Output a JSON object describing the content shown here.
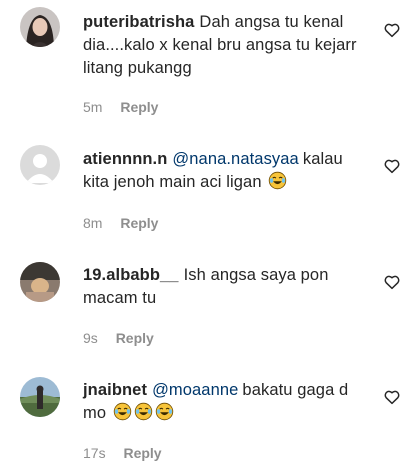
{
  "comments": [
    {
      "username": "puteribatrisha",
      "mention": "",
      "text": "Dah angsa tu kenal dia....kalo x kenal bru angsa tu kejarr litang pukangg",
      "emoji_count": 0,
      "time": "5m",
      "reply_label": "Reply",
      "avatar": "profile-photo-avatar"
    },
    {
      "username": "atiennnn.n",
      "mention": "@nana.natasyaa",
      "text": "kalau kita jenoh main aci ligan",
      "emoji_count": 1,
      "time": "8m",
      "reply_label": "Reply",
      "avatar": "default-avatar"
    },
    {
      "username": "19.albabb__",
      "mention": "",
      "text": "Ish angsa saya pon macam tu",
      "emoji_count": 0,
      "time": "9s",
      "reply_label": "Reply",
      "avatar": "profile-photo-avatar"
    },
    {
      "username": "jnaibnet",
      "mention": "@moaanne",
      "text": "bakatu gaga d mo",
      "emoji_count": 3,
      "time": "17s",
      "reply_label": "Reply",
      "avatar": "profile-photo-avatar"
    }
  ],
  "colors": {
    "text": "#262626",
    "mention": "#00376b",
    "meta": "#8e8e8e",
    "emoji": "#f7c43a"
  },
  "icons": {
    "like": "heart-outline-icon",
    "emoji": "laughing-with-tears-emoji"
  }
}
